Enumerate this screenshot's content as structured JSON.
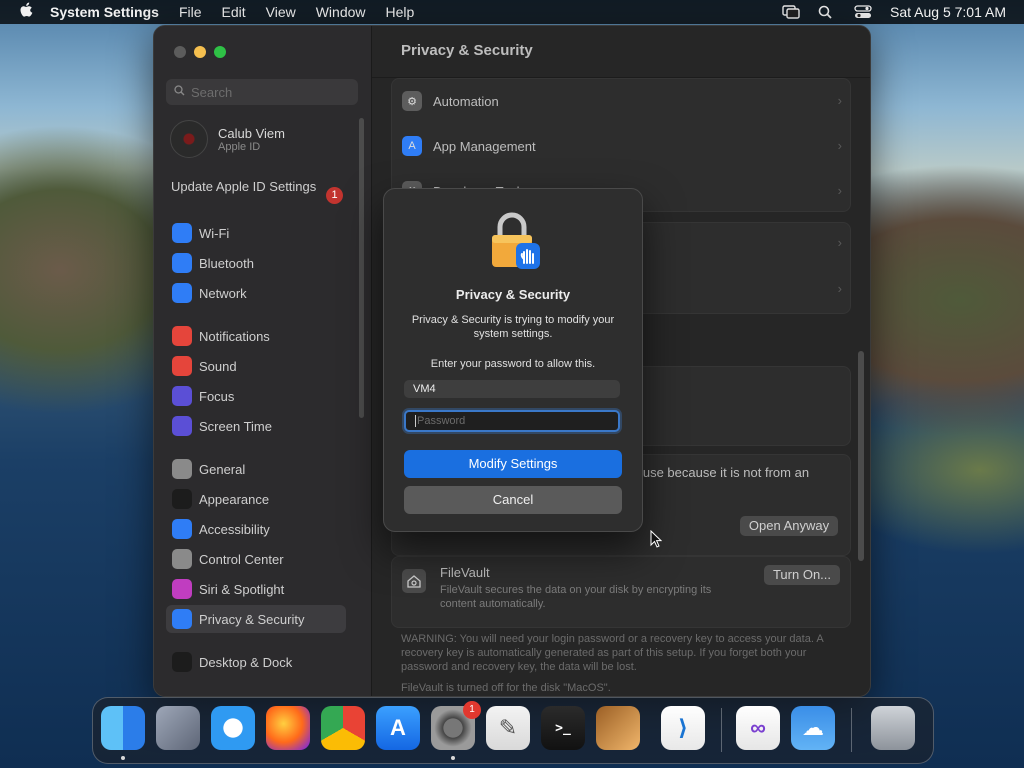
{
  "menubar": {
    "app_name": "System Settings",
    "menus": [
      "File",
      "Edit",
      "View",
      "Window",
      "Help"
    ],
    "clock": "Sat Aug 5  7:01 AM"
  },
  "sidebar": {
    "search_placeholder": "Search",
    "account": {
      "name": "Calub Viem",
      "sub": "Apple ID"
    },
    "update": {
      "label": "Update Apple ID Settings",
      "badge": "1"
    },
    "items": [
      {
        "label": "Wi-Fi",
        "icon": "wifi-icon",
        "color": "#2f7df6"
      },
      {
        "label": "Bluetooth",
        "icon": "bluetooth-icon",
        "color": "#2f7df6"
      },
      {
        "label": "Network",
        "icon": "globe-icon",
        "color": "#2f7df6"
      },
      {
        "label": "Notifications",
        "icon": "bell-icon",
        "color": "#e5453b"
      },
      {
        "label": "Sound",
        "icon": "speaker-icon",
        "color": "#e5453b"
      },
      {
        "label": "Focus",
        "icon": "moon-icon",
        "color": "#5b4fd6"
      },
      {
        "label": "Screen Time",
        "icon": "hourglass-icon",
        "color": "#5b4fd6"
      },
      {
        "label": "General",
        "icon": "gear-icon",
        "color": "#8a8a8a"
      },
      {
        "label": "Appearance",
        "icon": "appearance-icon",
        "color": "#1c1c1c"
      },
      {
        "label": "Accessibility",
        "icon": "accessibility-icon",
        "color": "#2f7df6"
      },
      {
        "label": "Control Center",
        "icon": "control-center-icon",
        "color": "#8a8a8a"
      },
      {
        "label": "Siri & Spotlight",
        "icon": "siri-icon",
        "color": "#c03dc0"
      },
      {
        "label": "Privacy & Security",
        "icon": "hand-icon",
        "color": "#2f7df6"
      },
      {
        "label": "Desktop & Dock",
        "icon": "dock-icon",
        "color": "#1c1c1c"
      }
    ]
  },
  "content": {
    "title": "Privacy & Security",
    "rows": [
      {
        "label": "Automation",
        "icon": "gears-icon"
      },
      {
        "label": "App Management",
        "icon": "appstore-icon"
      },
      {
        "label": "Developer Tools",
        "icon": "hammer-icon"
      }
    ],
    "blocked_text": "n use because it is not from an",
    "open_anyway": "Open Anyway",
    "filevault": {
      "title": "FileVault",
      "desc": "FileVault secures the data on your disk by encrypting its content automatically.",
      "button": "Turn On...",
      "warning": "WARNING: You will need your login password or a recovery key to access your data. A recovery key is automatically generated as part of this setup. If you forget both your password and recovery key, the data will be lost.",
      "status": "FileVault is turned off for the disk \"MacOS\"."
    }
  },
  "dialog": {
    "title": "Privacy & Security",
    "message": "Privacy & Security is trying to modify your system settings.",
    "prompt": "Enter your password to allow this.",
    "username": "VM4",
    "password_placeholder": "Password",
    "primary": "Modify Settings",
    "secondary": "Cancel"
  },
  "dock": {
    "apps": [
      {
        "name": "Finder",
        "icon": "finder-icon",
        "running": true
      },
      {
        "name": "Launchpad",
        "icon": "launchpad-icon",
        "running": false
      },
      {
        "name": "Safari",
        "icon": "safari-icon",
        "running": false
      },
      {
        "name": "Firefox",
        "icon": "firefox-icon",
        "running": false
      },
      {
        "name": "Chrome",
        "icon": "chrome-icon",
        "running": false
      },
      {
        "name": "App Store",
        "icon": "appstore-icon",
        "running": false
      },
      {
        "name": "System Settings",
        "icon": "system-settings-icon",
        "running": true,
        "badge": "1"
      },
      {
        "name": "TextEdit",
        "icon": "textedit-icon",
        "running": false
      },
      {
        "name": "Terminal",
        "icon": "terminal-icon",
        "running": false
      },
      {
        "name": "Instruments",
        "icon": "instruments-icon",
        "running": false
      },
      {
        "name": "VS Code",
        "icon": "vscode-icon",
        "running": false
      },
      {
        "name": "Visual Studio",
        "icon": "visual-studio-icon",
        "running": false
      },
      {
        "name": "Weather",
        "icon": "weather-icon",
        "running": false
      },
      {
        "name": "Trash",
        "icon": "trash-icon",
        "running": false
      }
    ]
  }
}
